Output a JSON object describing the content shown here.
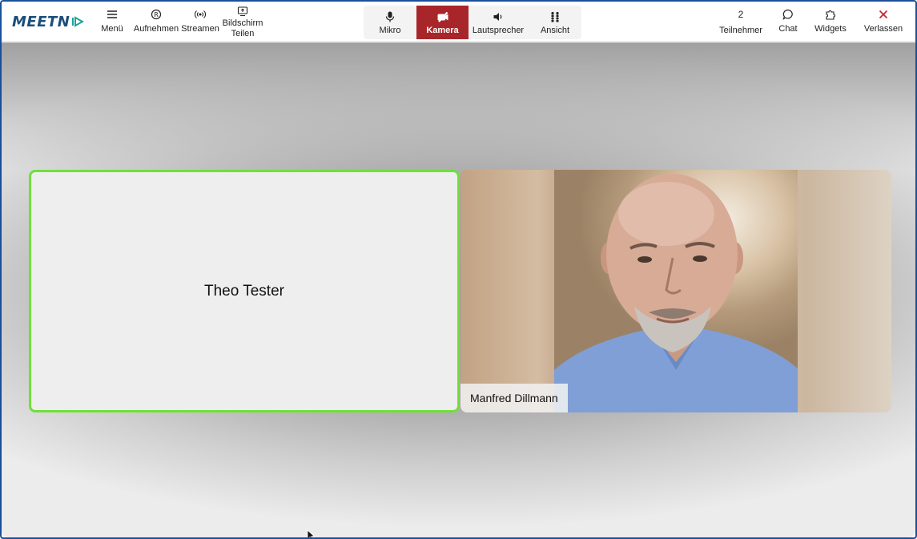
{
  "app": {
    "logo_text": "MEETN",
    "brand_color": "#1b4f7a",
    "accent_color": "#1aa39a"
  },
  "toolbar_left": [
    {
      "id": "menu",
      "label": "Menü",
      "icon": "hamburger-icon"
    },
    {
      "id": "record",
      "label": "Aufnehmen",
      "icon": "record-icon"
    },
    {
      "id": "stream",
      "label": "Streamen",
      "icon": "broadcast-icon"
    },
    {
      "id": "share",
      "label_line1": "Bildschirm",
      "label_line2": "Teilen",
      "icon": "screen-share-icon"
    }
  ],
  "toolbar_center": [
    {
      "id": "mic",
      "label": "Mikro",
      "icon": "microphone-icon",
      "active": false
    },
    {
      "id": "camera",
      "label": "Kamera",
      "icon": "camera-off-icon",
      "active": true
    },
    {
      "id": "speaker",
      "label": "Lautsprecher",
      "icon": "speaker-icon",
      "active": false
    },
    {
      "id": "view",
      "label": "Ansicht",
      "icon": "grid-view-icon",
      "active": false
    }
  ],
  "toolbar_right": {
    "participants": {
      "count": "2",
      "label": "Teilnehmer"
    },
    "chat": {
      "label": "Chat",
      "icon": "chat-bubble-icon"
    },
    "widgets": {
      "label": "Widgets",
      "icon": "puzzle-icon"
    },
    "leave": {
      "label": "Verlassen",
      "icon": "close-icon",
      "color": "#c0262d"
    }
  },
  "participants": [
    {
      "name": "Theo Tester",
      "video": false,
      "speaking": true,
      "speaking_border_color": "#6fe03a"
    },
    {
      "name": "Manfred Dillmann",
      "video": true,
      "speaking": false
    }
  ],
  "active_button_color": "#a8262a"
}
